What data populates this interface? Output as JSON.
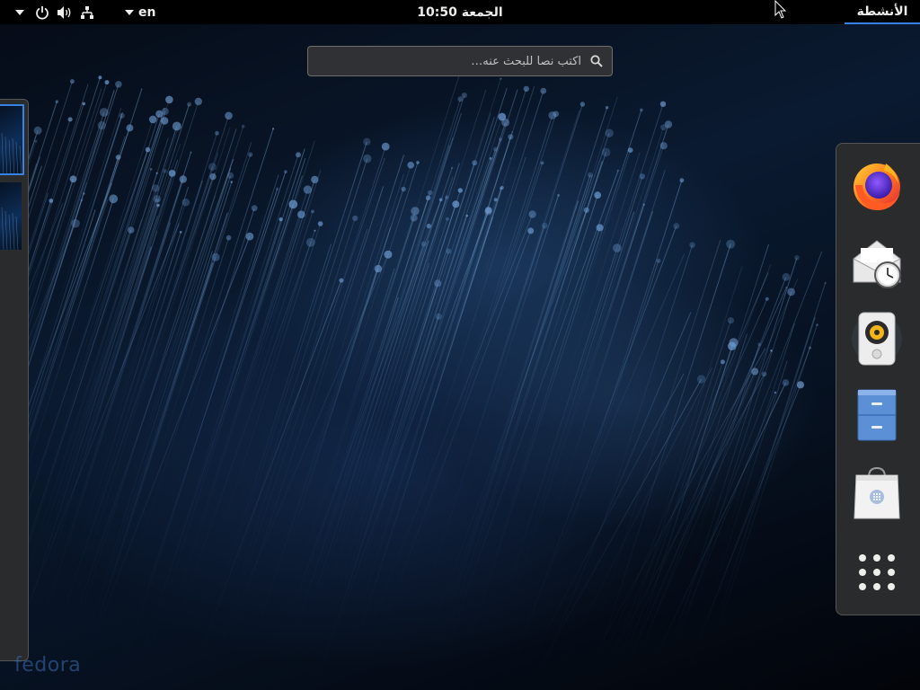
{
  "topbar": {
    "activities_label": "الأنشطة",
    "clock": "الجمعة 10:50",
    "input_source": "en"
  },
  "search": {
    "placeholder": "اكتب نصا للبحث عنه…"
  },
  "dash": {
    "items": [
      {
        "icon": "firefox-icon"
      },
      {
        "icon": "evolution-mail-icon"
      },
      {
        "icon": "rhythmbox-icon"
      },
      {
        "icon": "files-icon"
      },
      {
        "icon": "software-icon"
      },
      {
        "icon": "show-applications-icon"
      }
    ]
  },
  "watermark": "fedora",
  "colors": {
    "accent": "#3584e4",
    "panel": "#2a2b2d",
    "topbar": "#000000"
  }
}
